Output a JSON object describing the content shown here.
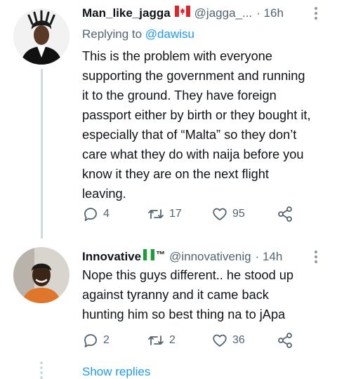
{
  "tweets": [
    {
      "display_name": "Man_like_jagga",
      "flag": "canada-flag",
      "handle": "@jagga_...",
      "time": "· 16h",
      "replying_label": "Replying to ",
      "replying_mention": "@dawisu",
      "lines": [
        "This is the problem with everyone",
        "supporting the government and running",
        "it to the ground. They have foreign",
        "passport either by birth or they bought it,",
        "especially that of “Malta” so they don’t",
        "care what they do with naija before you",
        "know it they are on the next flight",
        "leaving."
      ],
      "replies": "4",
      "retweets": "17",
      "likes": "95"
    },
    {
      "display_name": "Innovative",
      "flag": "nigeria-flag",
      "tm": "™",
      "handle": "@innovativenig",
      "time": "· 14h",
      "lines": [
        "Nope this guys different.. he stood up",
        "against tyranny and it came back",
        "hunting him so best thing na to jApa"
      ],
      "replies": "2",
      "retweets": "2",
      "likes": "36"
    }
  ],
  "show_replies": "Show replies",
  "colors": {
    "link": "#1d9bf0",
    "muted": "#536471",
    "text": "#0f1419"
  }
}
